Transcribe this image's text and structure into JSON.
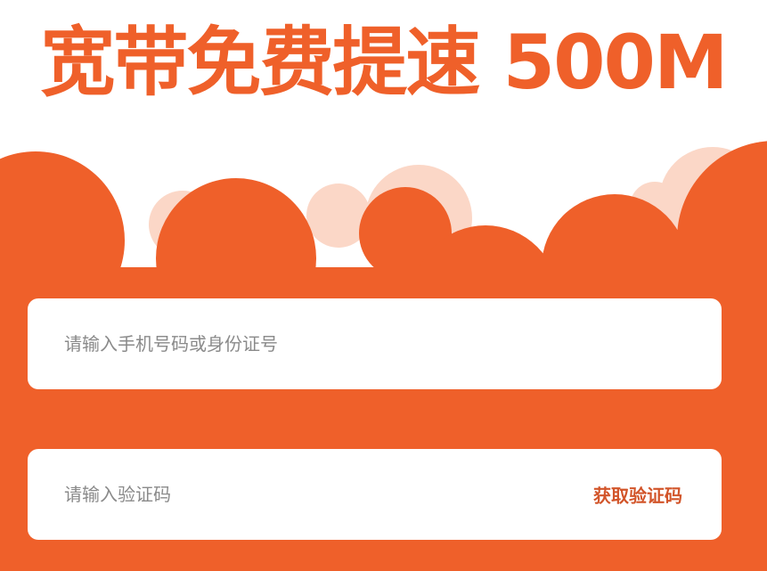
{
  "headline": {
    "text": "宽带免费提速 500M"
  },
  "form": {
    "phone": {
      "placeholder": "请输入手机号码或身份证号",
      "value": ""
    },
    "code": {
      "placeholder": "请输入验证码",
      "value": ""
    },
    "get_code_label": "获取验证码"
  },
  "colors": {
    "brand": "#ef602a",
    "cloud_light": "#fbd7c7",
    "link": "#d2552a"
  }
}
